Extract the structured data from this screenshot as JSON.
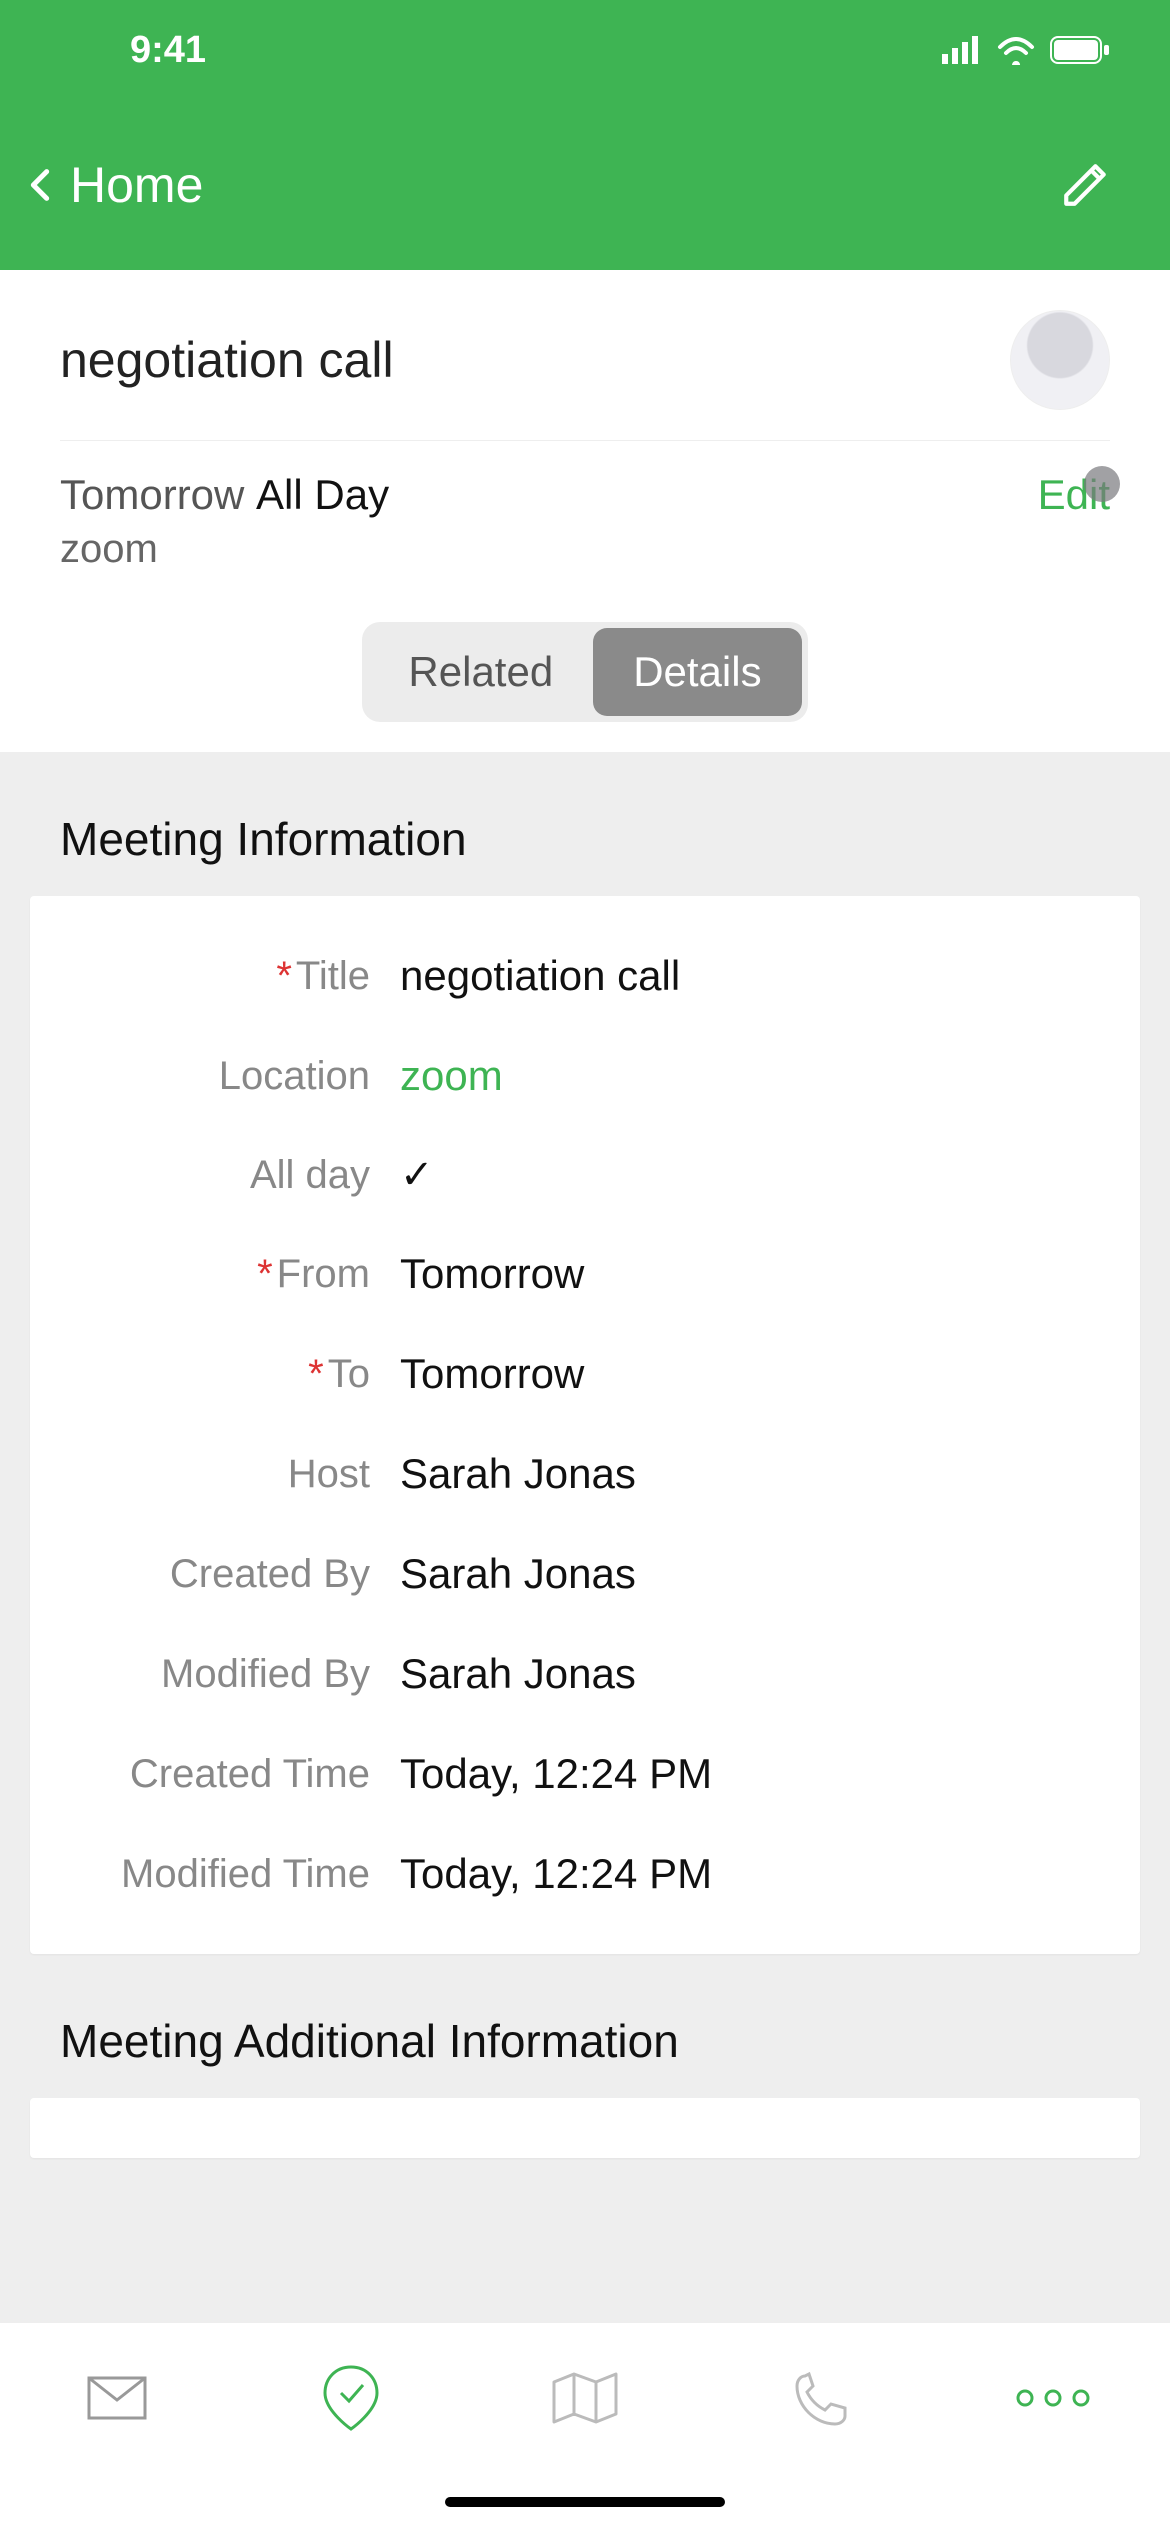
{
  "status": {
    "time": "9:41"
  },
  "nav": {
    "back_label": "Home"
  },
  "summary": {
    "title": "negotiation call",
    "date_prefix": "Tomorrow",
    "date_bold": "All Day",
    "location": "zoom",
    "edit_label": "Edit"
  },
  "tabs": {
    "related": "Related",
    "details": "Details"
  },
  "sections": {
    "info_title": "Meeting Information",
    "additional_title": "Meeting Additional Information"
  },
  "fields": {
    "title_label": "Title",
    "title_value": "negotiation call",
    "location_label": "Location",
    "location_value": "zoom",
    "allday_label": "All day",
    "allday_value": "✓",
    "from_label": "From",
    "from_value": "Tomorrow",
    "to_label": "To",
    "to_value": "Tomorrow",
    "host_label": "Host",
    "host_value": "Sarah Jonas",
    "createdby_label": "Created By",
    "createdby_value": "Sarah Jonas",
    "modifiedby_label": "Modified By",
    "modifiedby_value": "Sarah Jonas",
    "createdtime_label": "Created Time",
    "createdtime_value": "Today, 12:24 PM",
    "modifiedtime_label": "Modified Time",
    "modifiedtime_value": "Today, 12:24 PM"
  }
}
